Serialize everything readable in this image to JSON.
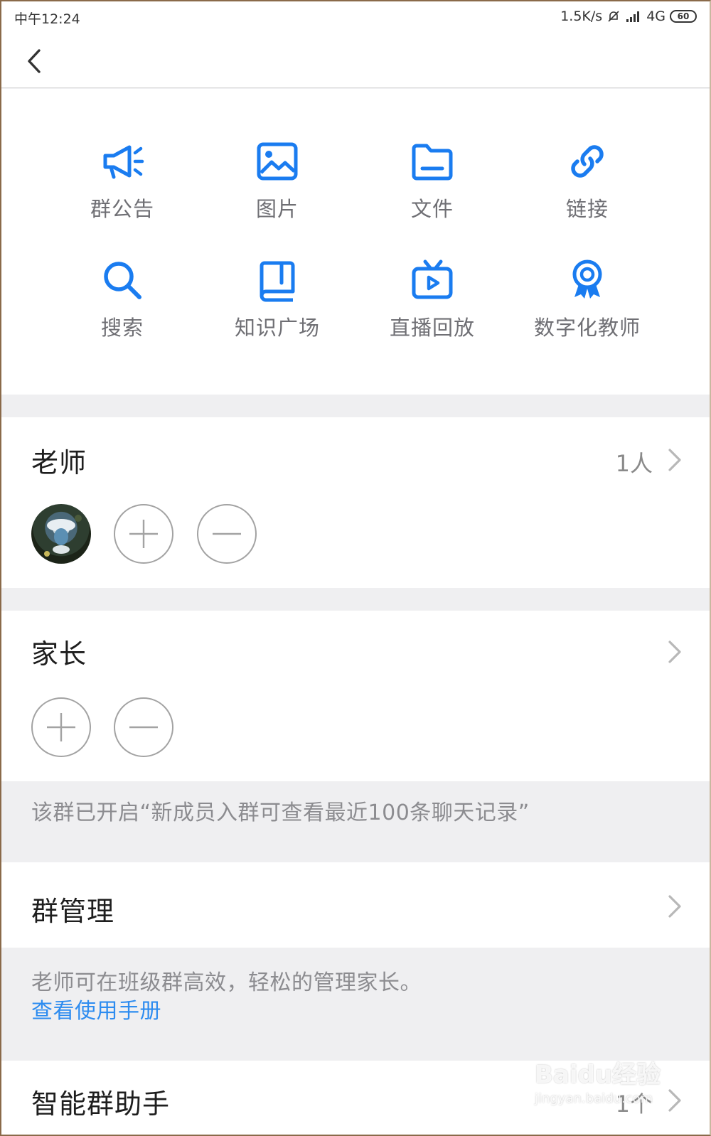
{
  "status_bar": {
    "time": "中午12:24",
    "speed": "1.5K/s",
    "network": "4G",
    "battery": "60"
  },
  "nav": {
    "back_icon": "chevron-left-icon"
  },
  "quick_actions": [
    {
      "label": "群公告",
      "icon": "megaphone-icon"
    },
    {
      "label": "图片",
      "icon": "image-icon"
    },
    {
      "label": "文件",
      "icon": "folder-icon"
    },
    {
      "label": "链接",
      "icon": "link-icon"
    },
    {
      "label": "搜索",
      "icon": "search-icon"
    },
    {
      "label": "知识广场",
      "icon": "book-icon"
    },
    {
      "label": "直播回放",
      "icon": "tv-play-icon"
    },
    {
      "label": "数字化教师",
      "icon": "award-badge-icon"
    }
  ],
  "teachers": {
    "title": "老师",
    "count": "1人"
  },
  "parents": {
    "title": "家长"
  },
  "history_notice": "该群已开启“新成员入群可查看最近100条聊天记录”",
  "group_manage": {
    "title": "群管理"
  },
  "manage_note": {
    "text": "老师可在班级群高效，轻松的管理家长。",
    "link": "查看使用手册"
  },
  "assistant": {
    "title": "智能群助手",
    "count": "1个"
  },
  "watermark": {
    "brand": "Baidu经验",
    "url": "jingyan.baidu.com"
  },
  "colors": {
    "accent": "#2d8cf0",
    "icon_blue": "#1a7cf0"
  }
}
